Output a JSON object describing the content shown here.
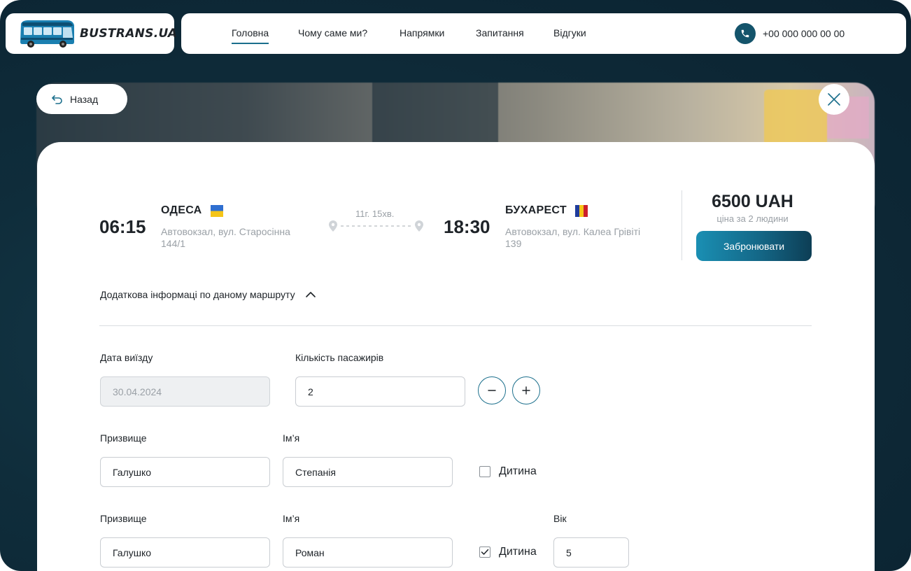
{
  "brand": {
    "name": "BUSTRANS.UA"
  },
  "nav": {
    "items": [
      {
        "label": "Головна",
        "active": true
      },
      {
        "label": "Чому саме ми?"
      },
      {
        "label": "Напрямки"
      },
      {
        "label": "Запитання"
      },
      {
        "label": "Відгуки"
      }
    ],
    "phone": "+00 000 000 00 00"
  },
  "back_label": "Назад",
  "trip": {
    "departure": {
      "time": "06:15",
      "city": "ОДЕСА",
      "address": "Автовокзал, вул. Старосінна 144/1"
    },
    "duration": "11г. 15хв.",
    "arrival": {
      "time": "18:30",
      "city": "БУХАРЕСТ",
      "address": "Автовокзал, вул. Калеа Грівіті 139"
    },
    "price": "6500 UAH",
    "price_note": "ціна за 2 людини",
    "book_label": "Забронювати"
  },
  "more_info_label": "Додаткова інформаці по даному маршруту",
  "form": {
    "date_label": "Дата виїзду",
    "date_value": "30.04.2024",
    "passengers_label": "Кількість пасажирів",
    "passengers_value": "2",
    "passengers": [
      {
        "surname_label": "Призвище",
        "surname": "Галушко",
        "name_label": "Ім’я",
        "name": "Степанія",
        "child_label": "Дитина",
        "is_child": false
      },
      {
        "surname_label": "Призвище",
        "surname": "Галушко",
        "name_label": "Ім’я",
        "name": "Роман",
        "child_label": "Дитина",
        "is_child": true,
        "age_label": "Вік",
        "age": "5"
      }
    ]
  },
  "colors": {
    "accent": "#1b6f8c",
    "button_gradient_start": "#1a8fb3",
    "button_gradient_end": "#0d3e55",
    "background": "#0f2d3b",
    "flag_ua_top": "#2f6fd0",
    "flag_ua_bottom": "#f5c518",
    "flag_ro": [
      "#1f3c9c",
      "#f5c518",
      "#cc1f2b"
    ]
  }
}
